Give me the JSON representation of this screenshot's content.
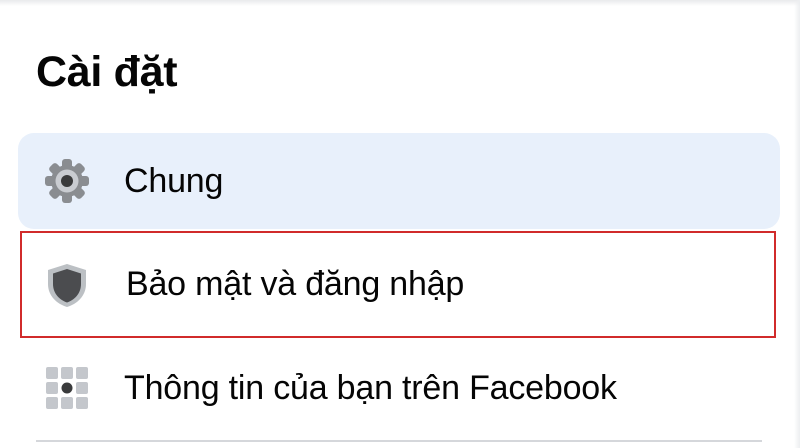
{
  "page": {
    "title": "Cài đặt"
  },
  "settings": {
    "items": [
      {
        "label": "Chung",
        "icon": "gear-icon",
        "state": "selected"
      },
      {
        "label": "Bảo mật và đăng nhập",
        "icon": "shield-icon",
        "state": "highlighted"
      },
      {
        "label": "Thông tin của bạn trên Facebook",
        "icon": "grid-icon",
        "state": "normal"
      }
    ]
  },
  "colors": {
    "selected_background": "#e8f0fb",
    "highlight_border": "#d12b2b",
    "text": "#050505",
    "icon_gray": "#8a8d91",
    "icon_dark": "#3a3b3c"
  }
}
